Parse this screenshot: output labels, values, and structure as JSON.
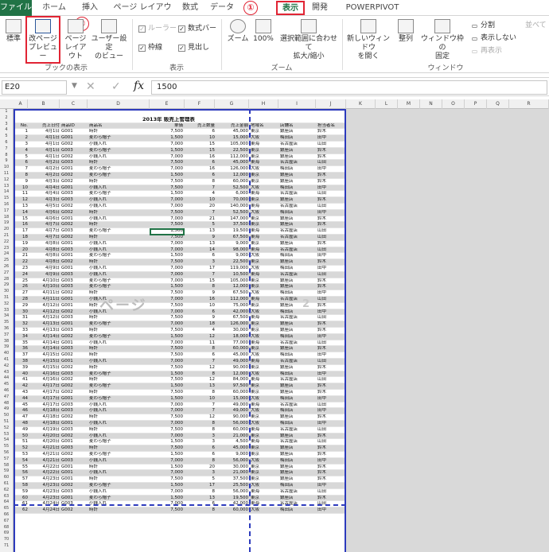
{
  "tabs": [
    "ファイル",
    "ホーム",
    "挿入",
    "ページ レイアウト",
    "数式",
    "データ",
    "表示",
    "開発",
    "POWERPIVOT"
  ],
  "ribbon": {
    "normal": "標準",
    "pagebreak": "改ページ\nプレビュー",
    "pagelayout": "ページ\nレイアウト",
    "userview": "ユーザー設定\nのビュー",
    "grp_book": "ブックの表示",
    "ruler": "ルーラー",
    "formulabar": "数式バー",
    "gridlines": "枠線",
    "headings": "見出し",
    "grp_show": "表示",
    "zoom": "ズーム",
    "hundred": "100%",
    "zoomsel": "選択範囲に合わせて\n拡大/縮小",
    "grp_zoom": "ズーム",
    "newwin": "新しいウィンドウ\nを開く",
    "arrange": "整列",
    "freeze": "ウィンドウ枠の\n固定",
    "split": "分割",
    "hide": "表示しない",
    "unhide": "再表示",
    "side": "並べて",
    "grp_win": "ウィンドウ",
    "callout1": "①",
    "callout2": "②"
  },
  "formula": {
    "namebox": "E20",
    "value": "1500"
  },
  "cols": [
    "A",
    "B",
    "C",
    "D",
    "E",
    "F",
    "G",
    "H",
    "I",
    "J",
    "K",
    "L",
    "M",
    "N",
    "O",
    "P",
    "Q",
    "R"
  ],
  "sheet": {
    "title": "2013年 販売上管理表",
    "headers": [
      "No.",
      "売上日付",
      "商品ID",
      "商品名",
      "単価",
      "売上数量",
      "売上金額",
      "地域名",
      "店舗名",
      "担当者名"
    ],
    "rows": [
      [
        "1",
        "4月1日",
        "G001",
        "時計",
        "7,500",
        "6",
        "45,000",
        "東京",
        "銀座店",
        "鈴木"
      ],
      [
        "2",
        "4月1日",
        "G001",
        "麦わら帽子",
        "1,500",
        "10",
        "15,000",
        "大阪",
        "梅田店",
        "田中"
      ],
      [
        "3",
        "4月1日",
        "G002",
        "小銭入れ",
        "7,000",
        "15",
        "105,000",
        "東海",
        "名古屋店",
        "山田"
      ],
      [
        "4",
        "4月1日",
        "G003",
        "麦わら帽子",
        "1,500",
        "15",
        "22,500",
        "東京",
        "銀座店",
        "鈴木"
      ],
      [
        "5",
        "4月1日",
        "G002",
        "小銭入れ",
        "7,000",
        "16",
        "112,000",
        "東京",
        "銀座店",
        "鈴木"
      ],
      [
        "6",
        "4月2日",
        "G003",
        "時計",
        "7,500",
        "6",
        "45,000",
        "東海",
        "名古屋店",
        "山田"
      ],
      [
        "7",
        "4月2日",
        "G001",
        "麦わら帽子",
        "7,000",
        "16",
        "126,000",
        "大阪",
        "梅田店",
        "田中"
      ],
      [
        "8",
        "4月2日",
        "G002",
        "麦わら帽子",
        "1,500",
        "6",
        "12,000",
        "東京",
        "銀座店",
        "鈴木"
      ],
      [
        "9",
        "4月3日",
        "G002",
        "時計",
        "7,500",
        "8",
        "60,000",
        "東京",
        "銀座店",
        "鈴木"
      ],
      [
        "10",
        "4月4日",
        "G001",
        "小銭入れ",
        "7,500",
        "7",
        "52,500",
        "大阪",
        "梅田店",
        "田中"
      ],
      [
        "11",
        "4月4日",
        "G003",
        "麦わら帽子",
        "1,500",
        "4",
        "6,000",
        "東海",
        "名古屋店",
        "山田"
      ],
      [
        "12",
        "4月3日",
        "G003",
        "小銭入れ",
        "7,000",
        "10",
        "70,000",
        "東京",
        "銀座店",
        "鈴木"
      ],
      [
        "13",
        "4月5日",
        "G002",
        "小銭入れ",
        "7,000",
        "20",
        "140,000",
        "東海",
        "名古屋店",
        "山田"
      ],
      [
        "14",
        "4月6日",
        "G002",
        "時計",
        "7,500",
        "7",
        "52,500",
        "大阪",
        "梅田店",
        "田中"
      ],
      [
        "15",
        "4月6日",
        "G001",
        "小銭入れ",
        "7,000",
        "21",
        "147,000",
        "東京",
        "銀座店",
        "鈴木"
      ],
      [
        "16",
        "4月7日",
        "G002",
        "時計",
        "7,500",
        "5",
        "37,500",
        "東京",
        "銀座店",
        "鈴木"
      ],
      [
        "17",
        "4月7日",
        "G003",
        "麦わら帽子",
        "1,500",
        "13",
        "19,500",
        "東海",
        "名古屋店",
        "山田"
      ],
      [
        "18",
        "4月7日",
        "G002",
        "時計",
        "7,500",
        "9",
        "67,500",
        "東海",
        "名古屋店",
        "山田"
      ],
      [
        "19",
        "4月8日",
        "G001",
        "小銭入れ",
        "7,000",
        "13",
        "9,000",
        "東京",
        "銀座店",
        "鈴木"
      ],
      [
        "20",
        "4月8日",
        "G003",
        "小銭入れ",
        "7,000",
        "14",
        "98,000",
        "東海",
        "名古屋店",
        "山田"
      ],
      [
        "21",
        "4月8日",
        "G001",
        "麦わら帽子",
        "1,500",
        "6",
        "9,000",
        "大阪",
        "梅田店",
        "田中"
      ],
      [
        "22",
        "4月8日",
        "G002",
        "時計",
        "7,500",
        "3",
        "22,500",
        "東京",
        "銀座店",
        "鈴木"
      ],
      [
        "23",
        "4月9日",
        "G001",
        "小銭入れ",
        "7,000",
        "17",
        "119,000",
        "大阪",
        "梅田店",
        "田中"
      ],
      [
        "24",
        "4月9日",
        "G003",
        "小銭入れ",
        "7,000",
        "7",
        "10,500",
        "東海",
        "名古屋店",
        "山田"
      ],
      [
        "25",
        "4月10日",
        "G003",
        "麦わら帽子",
        "7,000",
        "15",
        "105,000",
        "東京",
        "銀座店",
        "鈴木"
      ],
      [
        "26",
        "4月10日",
        "G003",
        "麦わら帽子",
        "1,500",
        "8",
        "12,000",
        "東京",
        "銀座店",
        "鈴木"
      ],
      [
        "27",
        "4月11日",
        "G002",
        "時計",
        "7,500",
        "9",
        "67,500",
        "大阪",
        "梅田店",
        "田中"
      ],
      [
        "28",
        "4月11日",
        "G001",
        "小銭入れ",
        "7,000",
        "16",
        "112,000",
        "東海",
        "名古屋店",
        "山田"
      ],
      [
        "29",
        "4月12日",
        "G001",
        "時計",
        "7,500",
        "10",
        "75,000",
        "東京",
        "銀座店",
        "鈴木"
      ],
      [
        "30",
        "4月12日",
        "G002",
        "小銭入れ",
        "7,000",
        "6",
        "42,000",
        "大阪",
        "梅田店",
        "田中"
      ],
      [
        "31",
        "4月12日",
        "G003",
        "時計",
        "7,500",
        "9",
        "67,500",
        "東海",
        "名古屋店",
        "山田"
      ],
      [
        "32",
        "4月13日",
        "G001",
        "麦わら帽子",
        "7,000",
        "18",
        "126,000",
        "東京",
        "銀座店",
        "鈴木"
      ],
      [
        "33",
        "4月13日",
        "G003",
        "時計",
        "7,500",
        "4",
        "30,000",
        "東京",
        "銀座店",
        "鈴木"
      ],
      [
        "34",
        "4月14日",
        "G002",
        "麦わら帽子",
        "1,500",
        "12",
        "18,000",
        "大阪",
        "梅田店",
        "田中"
      ],
      [
        "35",
        "4月14日",
        "G001",
        "小銭入れ",
        "7,000",
        "11",
        "77,000",
        "東海",
        "名古屋店",
        "山田"
      ],
      [
        "36",
        "4月14日",
        "G003",
        "時計",
        "7,500",
        "8",
        "60,000",
        "東京",
        "銀座店",
        "鈴木"
      ],
      [
        "37",
        "4月15日",
        "G002",
        "時計",
        "7,500",
        "6",
        "45,000",
        "大阪",
        "梅田店",
        "田中"
      ],
      [
        "38",
        "4月15日",
        "G001",
        "小銭入れ",
        "7,000",
        "7",
        "49,000",
        "東海",
        "名古屋店",
        "山田"
      ],
      [
        "39",
        "4月15日",
        "G002",
        "時計",
        "7,500",
        "12",
        "90,000",
        "東京",
        "銀座店",
        "鈴木"
      ],
      [
        "40",
        "4月16日",
        "G003",
        "麦わら帽子",
        "1,500",
        "8",
        "12,000",
        "大阪",
        "梅田店",
        "田中"
      ],
      [
        "41",
        "4月16日",
        "G002",
        "時計",
        "7,500",
        "12",
        "84,000",
        "東海",
        "名古屋店",
        "山田"
      ],
      [
        "42",
        "4月17日",
        "G002",
        "麦わら帽子",
        "1,500",
        "13",
        "97,500",
        "東京",
        "銀座店",
        "鈴木"
      ],
      [
        "43",
        "4月17日",
        "G002",
        "時計",
        "7,500",
        "8",
        "60,000",
        "東京",
        "銀座店",
        "鈴木"
      ],
      [
        "44",
        "4月17日",
        "G001",
        "麦わら帽子",
        "1,500",
        "10",
        "15,000",
        "大阪",
        "梅田店",
        "田中"
      ],
      [
        "45",
        "4月17日",
        "G003",
        "小銭入れ",
        "7,000",
        "7",
        "49,000",
        "東海",
        "名古屋店",
        "山田"
      ],
      [
        "46",
        "4月18日",
        "G003",
        "小銭入れ",
        "7,000",
        "7",
        "49,000",
        "大阪",
        "梅田店",
        "田中"
      ],
      [
        "47",
        "4月18日",
        "G002",
        "時計",
        "7,500",
        "12",
        "90,000",
        "東京",
        "銀座店",
        "鈴木"
      ],
      [
        "48",
        "4月18日",
        "G001",
        "小銭入れ",
        "7,000",
        "8",
        "56,000",
        "大阪",
        "梅田店",
        "田中"
      ],
      [
        "49",
        "4月19日",
        "G003",
        "時計",
        "7,500",
        "8",
        "60,000",
        "東海",
        "名古屋店",
        "山田"
      ],
      [
        "50",
        "4月20日",
        "G002",
        "小銭入れ",
        "7,000",
        "3",
        "21,000",
        "東京",
        "銀座店",
        "鈴木"
      ],
      [
        "51",
        "4月20日",
        "G001",
        "麦わら帽子",
        "1,500",
        "3",
        "4,500",
        "東海",
        "名古屋店",
        "山田"
      ],
      [
        "52",
        "4月21日",
        "G003",
        "時計",
        "7,500",
        "6",
        "45,000",
        "東京",
        "銀座店",
        "鈴木"
      ],
      [
        "53",
        "4月21日",
        "G002",
        "麦わら帽子",
        "1,500",
        "6",
        "9,000",
        "東京",
        "銀座店",
        "鈴木"
      ],
      [
        "54",
        "4月21日",
        "G003",
        "小銭入れ",
        "7,000",
        "8",
        "56,000",
        "大阪",
        "梅田店",
        "田中"
      ],
      [
        "55",
        "4月22日",
        "G001",
        "時計",
        "1,500",
        "20",
        "30,000",
        "東京",
        "銀座店",
        "鈴木"
      ],
      [
        "56",
        "4月22日",
        "G001",
        "小銭入れ",
        "7,000",
        "3",
        "21,000",
        "東京",
        "銀座店",
        "鈴木"
      ],
      [
        "57",
        "4月23日",
        "G001",
        "時計",
        "7,500",
        "5",
        "37,500",
        "東京",
        "銀座店",
        "鈴木"
      ],
      [
        "58",
        "4月23日",
        "G002",
        "麦わら帽子",
        "1,500",
        "17",
        "25,500",
        "大阪",
        "梅田店",
        "田中"
      ],
      [
        "59",
        "4月23日",
        "G003",
        "小銭入れ",
        "7,000",
        "8",
        "56,000",
        "東海",
        "名古屋店",
        "山田"
      ],
      [
        "60",
        "4月23日",
        "G001",
        "麦わら帽子",
        "1,500",
        "13",
        "19,500",
        "東京",
        "銀座店",
        "鈴木"
      ],
      [
        "61",
        "4月24日",
        "G003",
        "小銭入れ",
        "7,000",
        "6",
        "42,000",
        "東海",
        "名古屋店",
        "山田"
      ],
      [
        "62",
        "4月24日",
        "G002",
        "時計",
        "7,500",
        "8",
        "60,000",
        "大阪",
        "梅田店",
        "田中"
      ]
    ]
  },
  "watermark": "ページ",
  "watermark2": "2"
}
